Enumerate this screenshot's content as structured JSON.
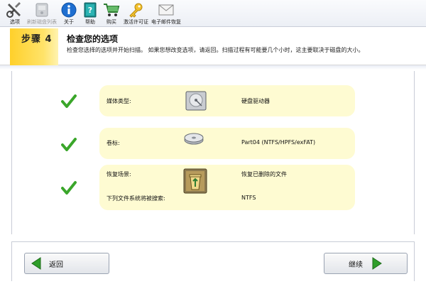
{
  "toolbar": {
    "items": [
      {
        "label": "选项",
        "icon": "tools-icon",
        "disabled": false
      },
      {
        "label": "刷新磁盘列表",
        "icon": "refresh-disk-list-icon",
        "disabled": true
      },
      {
        "label": "关于",
        "icon": "info-icon",
        "disabled": false
      },
      {
        "label": "帮助",
        "icon": "help-book-icon",
        "disabled": false
      },
      {
        "label": "购买",
        "icon": "shopping-cart-icon",
        "disabled": false
      },
      {
        "label": "激活许可证",
        "icon": "key-icon",
        "disabled": false
      },
      {
        "label": "电子邮件恢复",
        "icon": "envelope-icon",
        "disabled": false
      }
    ]
  },
  "step": {
    "badge": "步骤 4",
    "title": "检查您的选项",
    "description": "检查您选择的选项并开始扫描。 如果您想改变选项，请返回。扫描过程有可能要几个小时，这主要取决于磁盘的大小。"
  },
  "summary": {
    "media_type_label": "媒体类型:",
    "media_type_value": "硬盘驱动器",
    "volume_label": "卷标:",
    "volume_value": "Part04 (NTFS/HPFS/exFAT)",
    "scenario_label": "恢复场景:",
    "scenario_value": "恢复已删除的文件",
    "filesystem_label": "下列文件系统将被搜索:",
    "filesystem_value": "NTFS"
  },
  "buttons": {
    "back_label": "返回",
    "next_label": "继续"
  },
  "colors": {
    "card_bg": "#fefbd2",
    "step_badge": "#ffd02a",
    "check_green": "#3aa62a",
    "arrow_green": "#2f9e2a"
  }
}
